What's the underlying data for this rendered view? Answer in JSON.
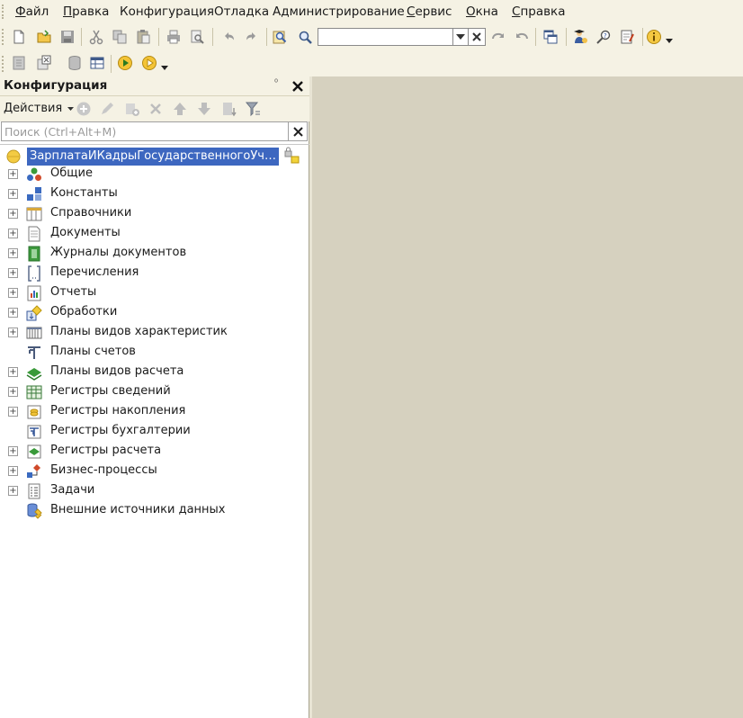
{
  "menu": {
    "items": [
      {
        "first": "Ф",
        "rest": "айл",
        "underline": true
      },
      {
        "first": "П",
        "rest": "равка",
        "underline": true
      },
      {
        "first": "",
        "rest": "Конфигурация",
        "underline": false
      },
      {
        "first": "",
        "rest": "Отладка",
        "underline": false
      },
      {
        "first": "",
        "rest": "Администрирование",
        "underline": false
      },
      {
        "first": "С",
        "rest": "ервис",
        "underline": true
      },
      {
        "first": "О",
        "rest": "кна",
        "underline": true
      },
      {
        "first": "С",
        "rest": "правка",
        "underline": true
      }
    ]
  },
  "toolbar": {
    "search_value": "",
    "icons": [
      "new-document-icon",
      "open-icon",
      "save-icon",
      "cut-icon",
      "copy-icon",
      "paste-icon",
      "print-icon",
      "print-preview-icon",
      "undo-icon",
      "redo-icon",
      "find-icon",
      "search-icon",
      "find-next-icon",
      "find-previous-icon",
      "window-icon",
      "open-configuration-icon",
      "syntax-assistant-icon",
      "edit-icon",
      "info-icon"
    ]
  },
  "panel": {
    "title": "Конфигурация",
    "pin_glyph": "⁰",
    "actions_label": "Действия",
    "search_placeholder": "Поиск (Ctrl+Alt+M)",
    "root_label": "ЗарплатаИКадрыГосударственногоУчреждения",
    "items": [
      {
        "label": "Общие",
        "icon": "common-icon",
        "expandable": true
      },
      {
        "label": "Константы",
        "icon": "constants-icon",
        "expandable": true
      },
      {
        "label": "Справочники",
        "icon": "catalogs-icon",
        "expandable": true
      },
      {
        "label": "Документы",
        "icon": "documents-icon",
        "expandable": true
      },
      {
        "label": "Журналы документов",
        "icon": "document-journals-icon",
        "expandable": true
      },
      {
        "label": "Перечисления",
        "icon": "enums-icon",
        "expandable": true
      },
      {
        "label": "Отчеты",
        "icon": "reports-icon",
        "expandable": true
      },
      {
        "label": "Обработки",
        "icon": "data-processors-icon",
        "expandable": true
      },
      {
        "label": "Планы видов характеристик",
        "icon": "characteristic-types-icon",
        "expandable": true
      },
      {
        "label": "Планы счетов",
        "icon": "chart-of-accounts-icon",
        "expandable": false
      },
      {
        "label": "Планы видов расчета",
        "icon": "calculation-types-icon",
        "expandable": true
      },
      {
        "label": "Регистры сведений",
        "icon": "information-registers-icon",
        "expandable": true
      },
      {
        "label": "Регистры накопления",
        "icon": "accumulation-registers-icon",
        "expandable": true
      },
      {
        "label": "Регистры бухгалтерии",
        "icon": "accounting-registers-icon",
        "expandable": false
      },
      {
        "label": "Регистры расчета",
        "icon": "calculation-registers-icon",
        "expandable": true
      },
      {
        "label": "Бизнес-процессы",
        "icon": "business-processes-icon",
        "expandable": true
      },
      {
        "label": "Задачи",
        "icon": "tasks-icon",
        "expandable": true
      },
      {
        "label": "Внешние источники данных",
        "icon": "external-data-sources-icon",
        "expandable": false
      }
    ]
  },
  "colors": {
    "chrome": "#f5f2e4",
    "workspace": "#d6d1bf",
    "selection": "#3d67c0"
  }
}
